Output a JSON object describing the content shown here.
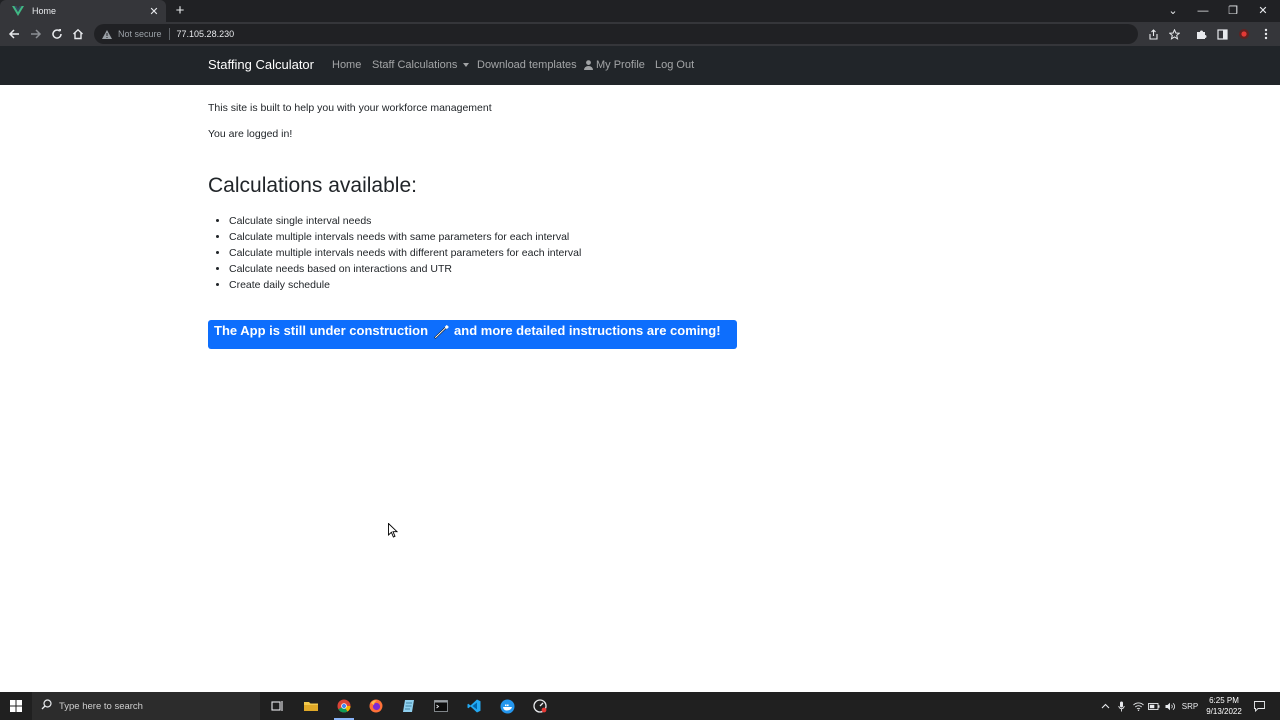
{
  "browser": {
    "tab_title": "Home",
    "security_label": "Not secure",
    "url": "77.105.28.230"
  },
  "navbar": {
    "brand": "Staffing Calculator",
    "items": [
      {
        "label": "Home"
      },
      {
        "label": "Staff Calculations"
      },
      {
        "label": "Download templates"
      },
      {
        "label": "My Profile"
      },
      {
        "label": "Log Out"
      }
    ]
  },
  "content": {
    "intro": "This site is built to help you with your workforce management",
    "logged_in": "You are logged in!",
    "heading": "Calculations available:",
    "calculations": [
      "Calculate single interval needs",
      "Calculate multiple intervals needs with same parameters for each interval",
      "Calculate multiple intervals needs with different parameters for each interval",
      "Calculate needs based on interactions and UTR",
      "Create daily schedule"
    ],
    "banner_before": "The App is still under construction",
    "banner_after": "and more detailed instructions are coming!"
  },
  "taskbar": {
    "search_placeholder": "Type here to search",
    "language": "SRP",
    "time": "6:25 PM",
    "date": "9/13/2022"
  },
  "colors": {
    "navbar_bg": "#212529",
    "banner_bg": "#0d6efd",
    "chrome_bg": "#35363a",
    "taskbar_bg": "#202020"
  }
}
